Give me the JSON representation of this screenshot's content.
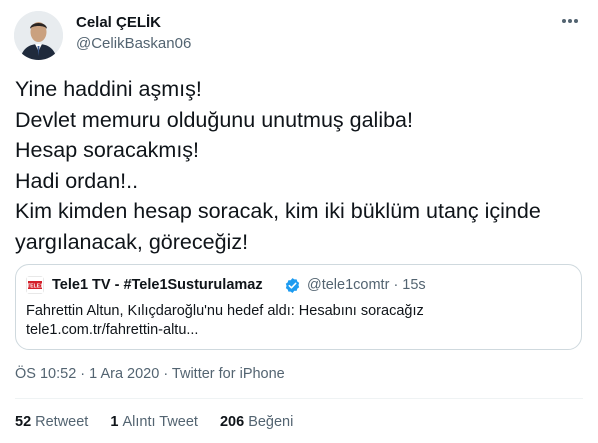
{
  "author": {
    "name": "Celal ÇELİK",
    "handle": "@CelikBaskan06"
  },
  "tweet": {
    "lines": [
      "Yine haddini aşmış!",
      "Devlet memuru olduğunu unutmuş galiba!",
      "Hesap soracakmış!",
      "Hadi ordan!..",
      "Kim kimden hesap soracak, kim iki büklüm utanç içinde",
      "yargılanacak, göreceğiz!"
    ]
  },
  "quoted": {
    "name": "Tele1 TV - #Tele1Susturulamaz",
    "handle_time": "@tele1comtr · 15s",
    "logo_text": "TELE1",
    "text_line1": "Fahrettin Altun, Kılıçdaroğlu'nu hedef aldı: Hesabını soracağız",
    "text_line2": "tele1.com.tr/fahrettin-altu..."
  },
  "meta": "ÖS 10:52 · 1 Ara 2020 · Twitter for iPhone",
  "stats": [
    {
      "count": "52",
      "label": "Retweet"
    },
    {
      "count": "1",
      "label": "Alıntı Tweet"
    },
    {
      "count": "206",
      "label": "Beğeni"
    }
  ],
  "colors": {
    "verified": "#1d9bf0",
    "secondary": "#536471",
    "border": "#cfd9de"
  }
}
